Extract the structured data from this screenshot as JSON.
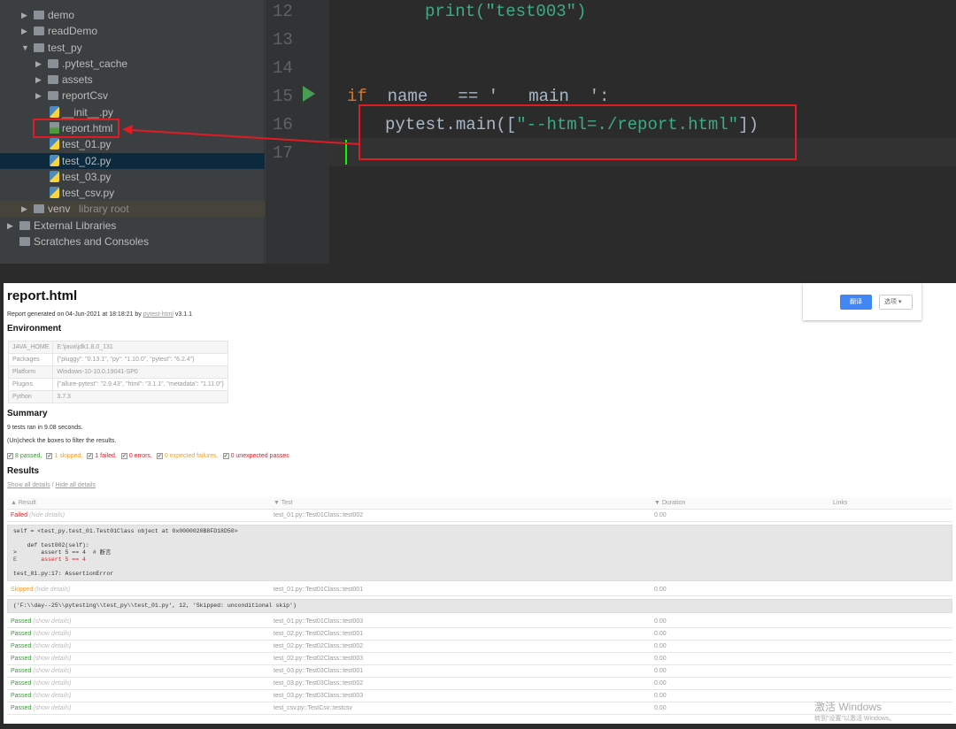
{
  "ide": {
    "tree": [
      {
        "label": "demo",
        "type": "folder",
        "depth": 1,
        "arrow": "▶"
      },
      {
        "label": "readDemo",
        "type": "folder",
        "depth": 1,
        "arrow": "▶"
      },
      {
        "label": "test_py",
        "type": "folder",
        "depth": 1,
        "arrow": "▼"
      },
      {
        "label": ".pytest_cache",
        "type": "folder",
        "depth": 2,
        "arrow": "▶"
      },
      {
        "label": "assets",
        "type": "folder",
        "depth": 2,
        "arrow": "▶"
      },
      {
        "label": "reportCsv",
        "type": "folder",
        "depth": 2,
        "arrow": "▶"
      },
      {
        "label": "__init__.py",
        "type": "py",
        "depth": 2
      },
      {
        "label": "report.html",
        "type": "html",
        "depth": 2
      },
      {
        "label": "test_01.py",
        "type": "py",
        "depth": 2
      },
      {
        "label": "test_02.py",
        "type": "py",
        "depth": 2,
        "selected": true
      },
      {
        "label": "test_03.py",
        "type": "py",
        "depth": 2
      },
      {
        "label": "test_csv.py",
        "type": "py",
        "depth": 2
      },
      {
        "label": "venv",
        "type": "folder",
        "depth": 1,
        "arrow": "▶",
        "note": "library root"
      },
      {
        "label": "External Libraries",
        "type": "lib",
        "depth": 0,
        "arrow": "▶"
      },
      {
        "label": "Scratches and Consoles",
        "type": "scratch",
        "depth": 0
      }
    ],
    "lines": [
      "12",
      "13",
      "14",
      "15",
      "16",
      "17"
    ],
    "code": {
      "l12": "print(\"test003\")",
      "l15_kw": "if",
      "l15_rest": "  name   == '   main  ':",
      "l16_fn": "pytest.main([",
      "l16_str": "\"--html=./report.html\"",
      "l16_end": "])"
    }
  },
  "report": {
    "title": "report.html",
    "generated": "Report generated on 04-Jun-2021 at 18:18:21 by",
    "generator_link": "pytest-html",
    "version": "v3.1.1",
    "environment_heading": "Environment",
    "environment": [
      {
        "key": "JAVA_HOME",
        "value": "E:\\java\\jdk1.8.0_131"
      },
      {
        "key": "Packages",
        "value": "{\"pluggy\": \"0.13.1\", \"py\": \"1.10.0\", \"pytest\": \"6.2.4\"}"
      },
      {
        "key": "Platform",
        "value": "Windows-10-10.0.19041-SP0"
      },
      {
        "key": "Plugins",
        "value": "{\"allure-pytest\": \"2.9.43\", \"html\": \"3.1.1\", \"metadata\": \"1.11.0\"}"
      },
      {
        "key": "Python",
        "value": "3.7.3"
      }
    ],
    "summary_heading": "Summary",
    "summary_text": "9 tests ran in 9.08 seconds.",
    "filter_hint": "(Un)check the boxes to filter the results.",
    "filters": [
      {
        "label": "8 passed,",
        "cls": "passed"
      },
      {
        "label": "1 skipped,",
        "cls": "skipped"
      },
      {
        "label": "1 failed,",
        "cls": "failed"
      },
      {
        "label": "0 errors,",
        "cls": "failed"
      },
      {
        "label": "0 expected failures,",
        "cls": "skipped"
      },
      {
        "label": "0 unexpected passes",
        "cls": "failed"
      }
    ],
    "results_heading": "Results",
    "show_all": "Show all details",
    "sep": " / ",
    "hide_all": "Hide all details",
    "columns": [
      "Result",
      "Test",
      "Duration",
      "Links"
    ],
    "rows": [
      {
        "result": "Failed",
        "cls": "failed",
        "details": "(hide details)",
        "test": "test_01.py::Test01Class::test002",
        "duration": "0.00",
        "log": [
          "self = <test_py.test_01.Test01Class object at 0x0000020B8FD18D50>",
          "",
          "    def test002(self):",
          ">       assert 5 == 4  # 断言"
        ],
        "log_err": "E       assert 5 == 4",
        "log_tail": [
          "",
          "test_01.py:17: AssertionError"
        ]
      },
      {
        "result": "Skipped",
        "cls": "skipped",
        "details": "(hide details)",
        "test": "test_01.py::Test01Class::test001",
        "duration": "0.00",
        "log": [
          "('F:\\\\day--25\\\\pytesting\\\\test_py\\\\test_01.py', 12, 'Skipped: unconditional skip')"
        ]
      },
      {
        "result": "Passed",
        "cls": "passed",
        "details": "(show details)",
        "test": "test_01.py::Test01Class::test003",
        "duration": "0.00"
      },
      {
        "result": "Passed",
        "cls": "passed",
        "details": "(show details)",
        "test": "test_02.py::Test02Class::test001",
        "duration": "0.00"
      },
      {
        "result": "Passed",
        "cls": "passed",
        "details": "(show details)",
        "test": "test_02.py::Test02Class::test002",
        "duration": "0.00"
      },
      {
        "result": "Passed",
        "cls": "passed",
        "details": "(show details)",
        "test": "test_02.py::Test02Class::test003",
        "duration": "0.00"
      },
      {
        "result": "Passed",
        "cls": "passed",
        "details": "(show details)",
        "test": "test_03.py::Test03Class::test001",
        "duration": "0.00"
      },
      {
        "result": "Passed",
        "cls": "passed",
        "details": "(show details)",
        "test": "test_03.py::Test03Class::test002",
        "duration": "0.00"
      },
      {
        "result": "Passed",
        "cls": "passed",
        "details": "(show details)",
        "test": "test_03.py::Test03Class::test003",
        "duration": "0.00"
      },
      {
        "result": "Passed",
        "cls": "passed",
        "details": "(show details)",
        "test": "test_csv.py::TestCsv::testcsv",
        "duration": "0.00"
      }
    ],
    "translate_popup": {
      "translate": "翻译",
      "options": "选项 ▾"
    },
    "watermark": {
      "line1": "激活 Windows",
      "line2": "转到\"设置\"以激活 Windows。"
    }
  }
}
